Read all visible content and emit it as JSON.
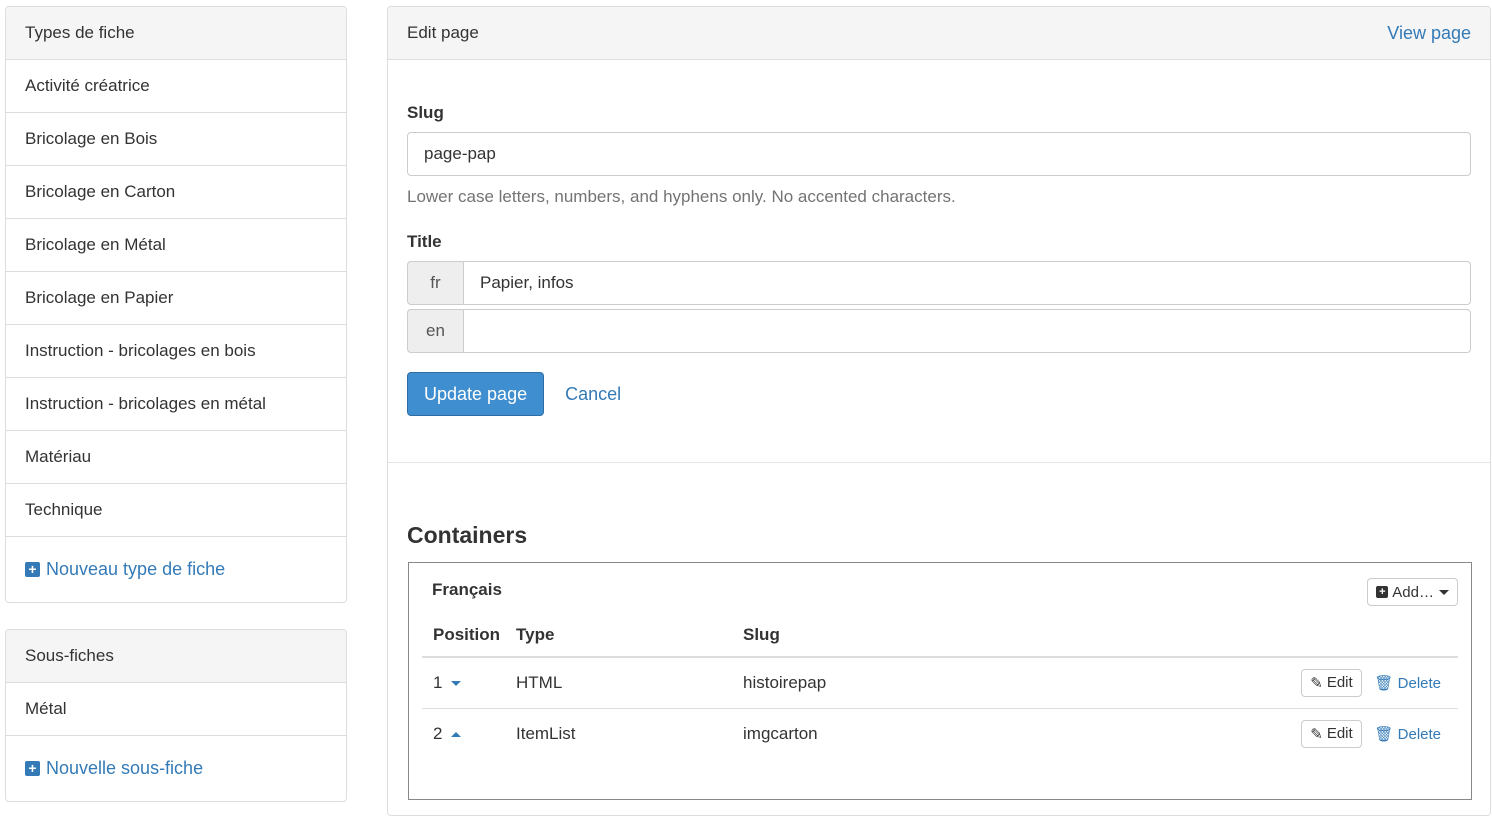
{
  "types_panel": {
    "title": "Types de fiche",
    "items": [
      "Activité créatrice",
      "Bricolage en Bois",
      "Bricolage en Carton",
      "Bricolage en Métal",
      "Bricolage en Papier",
      "Instruction - bricolages en bois",
      "Instruction - bricolages en métal",
      "Matériau",
      "Technique"
    ],
    "add_label": "Nouveau type de fiche"
  },
  "subsheets_panel": {
    "title": "Sous-fiches",
    "items": [
      "Métal"
    ],
    "add_label": "Nouvelle sous-fiche"
  },
  "edit_panel": {
    "title": "Edit page",
    "view_link": "View page",
    "slug_label": "Slug",
    "slug_value": "page-pap",
    "slug_help": "Lower case letters, numbers, and hyphens only. No accented characters.",
    "title_label": "Title",
    "title_fields": [
      {
        "lang": "fr",
        "value": "Papier, infos"
      },
      {
        "lang": "en",
        "value": ""
      }
    ],
    "update_button": "Update page",
    "cancel_link": "Cancel"
  },
  "containers": {
    "heading": "Containers",
    "language": "Français",
    "add_button": "Add…",
    "columns": [
      "Position",
      "Type",
      "Slug"
    ],
    "rows": [
      {
        "position": "1",
        "direction": "down",
        "type": "HTML",
        "slug": "histoirepap",
        "edit": "Edit",
        "delete": "Delete"
      },
      {
        "position": "2",
        "direction": "up",
        "type": "ItemList",
        "slug": "imgcarton",
        "edit": "Edit",
        "delete": "Delete"
      }
    ]
  },
  "colors": {
    "link": "#337ab7",
    "primary_button": "#3f8ed0",
    "panel_heading_bg": "#f5f5f5",
    "border": "#dddddd"
  },
  "icons": {
    "add": "plus-square-icon",
    "edit": "pencil-icon",
    "delete": "trash-icon",
    "move_down": "caret-down-icon",
    "move_up": "caret-up-icon"
  }
}
